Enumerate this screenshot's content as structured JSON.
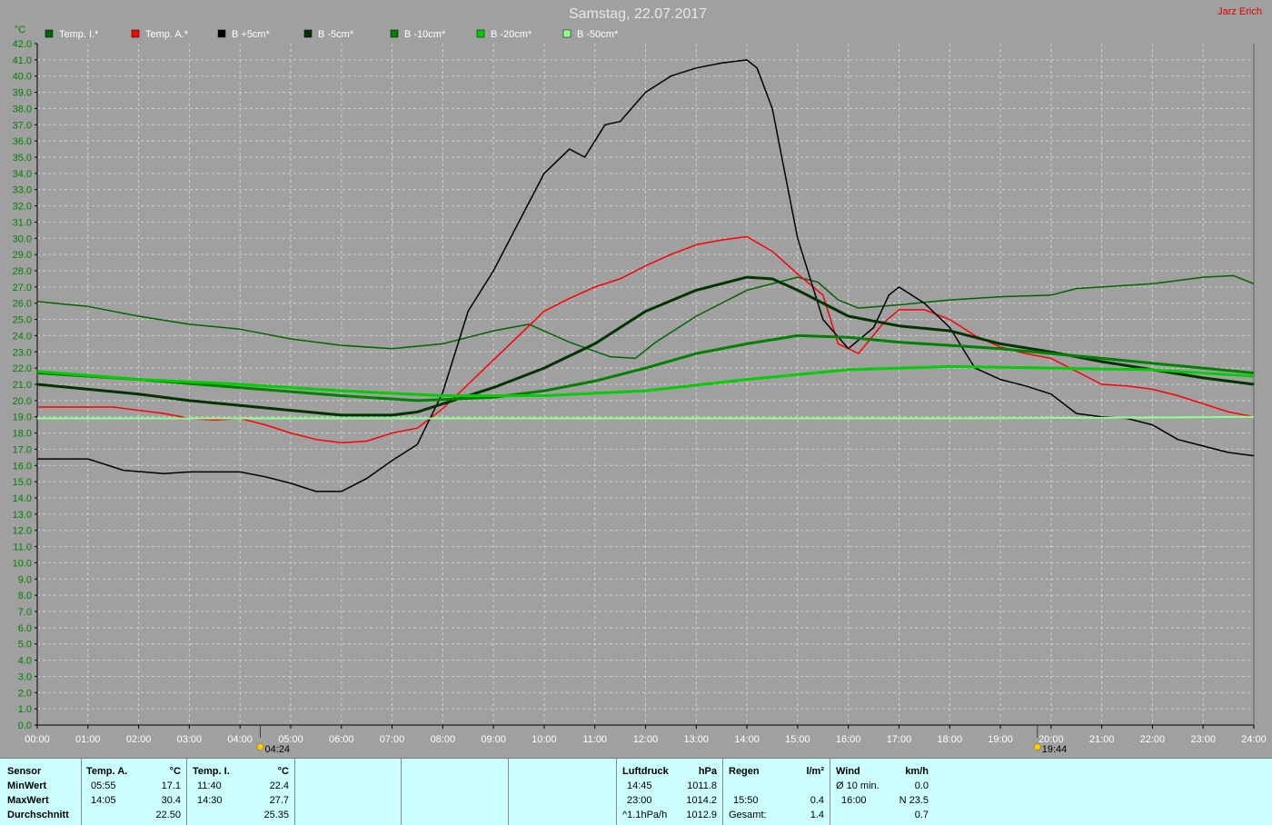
{
  "header": {
    "title": "Samstag, 22.07.2017",
    "author": "Jarz Erich"
  },
  "chart_data": {
    "type": "line",
    "title": "Samstag, 22.07.2017",
    "ylabel": "°C",
    "ylim": [
      0,
      42
    ],
    "xlim": [
      0,
      24
    ],
    "y_ticks": [
      "0.0",
      "1.0",
      "2.0",
      "3.0",
      "4.0",
      "5.0",
      "6.0",
      "7.0",
      "8.0",
      "9.0",
      "10.0",
      "11.0",
      "12.0",
      "13.0",
      "14.0",
      "15.0",
      "16.0",
      "17.0",
      "18.0",
      "19.0",
      "20.0",
      "21.0",
      "22.0",
      "23.0",
      "24.0",
      "25.0",
      "26.0",
      "27.0",
      "28.0",
      "29.0",
      "30.0",
      "31.0",
      "32.0",
      "33.0",
      "34.0",
      "35.0",
      "36.0",
      "37.0",
      "38.0",
      "39.0",
      "40.0",
      "41.0",
      "42.0"
    ],
    "x_ticks": [
      "00:00",
      "01:00",
      "02:00",
      "03:00",
      "04:00",
      "05:00",
      "06:00",
      "07:00",
      "08:00",
      "09:00",
      "10:00",
      "11:00",
      "12:00",
      "13:00",
      "14:00",
      "15:00",
      "16:00",
      "17:00",
      "18:00",
      "19:00",
      "20:00",
      "21:00",
      "22:00",
      "23:00",
      "24:00"
    ],
    "grid": true,
    "legend_position": "top",
    "sun_events": [
      {
        "label": "04:24",
        "hour": 4.4,
        "icon": "sunrise-icon"
      },
      {
        "label": "19:44",
        "hour": 19.73,
        "icon": "sunset-icon"
      }
    ],
    "series": [
      {
        "name": "Temp. I.*",
        "color": "#006400",
        "width": 1.5,
        "points": [
          [
            0,
            26.1
          ],
          [
            1,
            25.8
          ],
          [
            2,
            25.2
          ],
          [
            3,
            24.7
          ],
          [
            4,
            24.4
          ],
          [
            5,
            23.8
          ],
          [
            6,
            23.4
          ],
          [
            7,
            23.2
          ],
          [
            8,
            23.5
          ],
          [
            9,
            24.3
          ],
          [
            9.7,
            24.7
          ],
          [
            10.5,
            23.6
          ],
          [
            11.3,
            22.7
          ],
          [
            11.8,
            22.6
          ],
          [
            12.2,
            23.6
          ],
          [
            13,
            25.2
          ],
          [
            14,
            26.8
          ],
          [
            15,
            27.6
          ],
          [
            15.4,
            27.3
          ],
          [
            15.8,
            26.2
          ],
          [
            16.2,
            25.7
          ],
          [
            17,
            25.9
          ],
          [
            18,
            26.2
          ],
          [
            19,
            26.4
          ],
          [
            20,
            26.5
          ],
          [
            20.5,
            26.9
          ],
          [
            21,
            27.0
          ],
          [
            22,
            27.2
          ],
          [
            23,
            27.6
          ],
          [
            23.6,
            27.7
          ],
          [
            24,
            27.2
          ]
        ]
      },
      {
        "name": "Temp. A.*",
        "color": "#ff0000",
        "width": 1.5,
        "points": [
          [
            0,
            19.6
          ],
          [
            0.5,
            19.6
          ],
          [
            1,
            19.6
          ],
          [
            1.5,
            19.6
          ],
          [
            2,
            19.4
          ],
          [
            2.5,
            19.2
          ],
          [
            3,
            18.9
          ],
          [
            3.5,
            18.8
          ],
          [
            4,
            18.9
          ],
          [
            4.5,
            18.5
          ],
          [
            5,
            18.0
          ],
          [
            5.5,
            17.6
          ],
          [
            6,
            17.4
          ],
          [
            6.5,
            17.5
          ],
          [
            7,
            18.0
          ],
          [
            7.5,
            18.3
          ],
          [
            8,
            19.5
          ],
          [
            8.5,
            21.0
          ],
          [
            9,
            22.5
          ],
          [
            9.5,
            24.0
          ],
          [
            10,
            25.5
          ],
          [
            10.5,
            26.3
          ],
          [
            11,
            27.0
          ],
          [
            11.5,
            27.5
          ],
          [
            12,
            28.3
          ],
          [
            12.5,
            29.0
          ],
          [
            13,
            29.6
          ],
          [
            13.5,
            29.9
          ],
          [
            14,
            30.1
          ],
          [
            14.5,
            29.2
          ],
          [
            15,
            27.8
          ],
          [
            15.5,
            26.5
          ],
          [
            15.8,
            23.5
          ],
          [
            16.2,
            22.9
          ],
          [
            16.7,
            24.8
          ],
          [
            17,
            25.6
          ],
          [
            17.5,
            25.6
          ],
          [
            18,
            25.0
          ],
          [
            18.5,
            24.0
          ],
          [
            19,
            23.3
          ],
          [
            19.5,
            22.9
          ],
          [
            20,
            22.6
          ],
          [
            20.5,
            21.8
          ],
          [
            21,
            21.0
          ],
          [
            21.5,
            20.9
          ],
          [
            22,
            20.7
          ],
          [
            22.5,
            20.3
          ],
          [
            23,
            19.8
          ],
          [
            23.5,
            19.3
          ],
          [
            24,
            19.0
          ]
        ]
      },
      {
        "name": "B +5cm*",
        "color": "#000000",
        "width": 1.5,
        "points": [
          [
            0,
            16.4
          ],
          [
            1,
            16.4
          ],
          [
            1.7,
            15.7
          ],
          [
            2.5,
            15.5
          ],
          [
            3,
            15.6
          ],
          [
            4,
            15.6
          ],
          [
            4.5,
            15.3
          ],
          [
            5,
            14.9
          ],
          [
            5.5,
            14.4
          ],
          [
            6,
            14.4
          ],
          [
            6.5,
            15.2
          ],
          [
            7,
            16.3
          ],
          [
            7.5,
            17.3
          ],
          [
            8,
            20.5
          ],
          [
            8.5,
            25.5
          ],
          [
            9,
            28.0
          ],
          [
            9.5,
            31.0
          ],
          [
            10,
            34.0
          ],
          [
            10.5,
            35.5
          ],
          [
            10.8,
            35.0
          ],
          [
            11.2,
            37.0
          ],
          [
            11.5,
            37.2
          ],
          [
            12,
            39.0
          ],
          [
            12.5,
            40.0
          ],
          [
            13,
            40.5
          ],
          [
            13.5,
            40.8
          ],
          [
            14,
            41.0
          ],
          [
            14.2,
            40.5
          ],
          [
            14.5,
            38.0
          ],
          [
            15,
            30.0
          ],
          [
            15.5,
            25.0
          ],
          [
            16,
            23.2
          ],
          [
            16.5,
            24.5
          ],
          [
            16.8,
            26.5
          ],
          [
            17,
            27.0
          ],
          [
            17.5,
            26.0
          ],
          [
            18,
            24.5
          ],
          [
            18.5,
            22.0
          ],
          [
            19,
            21.3
          ],
          [
            19.5,
            20.9
          ],
          [
            20,
            20.4
          ],
          [
            20.5,
            19.2
          ],
          [
            21,
            19.0
          ],
          [
            21.5,
            18.9
          ],
          [
            22,
            18.5
          ],
          [
            22.5,
            17.6
          ],
          [
            23,
            17.2
          ],
          [
            23.5,
            16.8
          ],
          [
            24,
            16.6
          ]
        ]
      },
      {
        "name": "B -5cm*",
        "color": "#003300",
        "width": 3,
        "points": [
          [
            0,
            21.0
          ],
          [
            1,
            20.7
          ],
          [
            2,
            20.4
          ],
          [
            3,
            20.0
          ],
          [
            4,
            19.7
          ],
          [
            5,
            19.4
          ],
          [
            6,
            19.1
          ],
          [
            7,
            19.1
          ],
          [
            7.5,
            19.3
          ],
          [
            8,
            19.8
          ],
          [
            9,
            20.8
          ],
          [
            10,
            22.0
          ],
          [
            11,
            23.5
          ],
          [
            12,
            25.5
          ],
          [
            13,
            26.8
          ],
          [
            14,
            27.6
          ],
          [
            14.5,
            27.5
          ],
          [
            15,
            26.8
          ],
          [
            16,
            25.2
          ],
          [
            17,
            24.6
          ],
          [
            18,
            24.3
          ],
          [
            19,
            23.5
          ],
          [
            20,
            23.0
          ],
          [
            21,
            22.4
          ],
          [
            22,
            21.9
          ],
          [
            23,
            21.4
          ],
          [
            24,
            21.0
          ]
        ]
      },
      {
        "name": "B -10cm*",
        "color": "#008000",
        "width": 3,
        "points": [
          [
            0,
            21.7
          ],
          [
            2,
            21.3
          ],
          [
            4,
            20.8
          ],
          [
            6,
            20.3
          ],
          [
            7.5,
            20.0
          ],
          [
            9,
            20.2
          ],
          [
            10,
            20.6
          ],
          [
            11,
            21.2
          ],
          [
            12,
            22.0
          ],
          [
            13,
            22.9
          ],
          [
            14,
            23.5
          ],
          [
            15,
            24.0
          ],
          [
            16,
            23.9
          ],
          [
            17,
            23.6
          ],
          [
            18,
            23.4
          ],
          [
            19,
            23.2
          ],
          [
            20,
            22.9
          ],
          [
            21,
            22.6
          ],
          [
            22,
            22.3
          ],
          [
            23,
            22.0
          ],
          [
            24,
            21.7
          ]
        ]
      },
      {
        "name": "B -20cm*",
        "color": "#00cc00",
        "width": 3,
        "points": [
          [
            0,
            21.8
          ],
          [
            2,
            21.3
          ],
          [
            4,
            21.0
          ],
          [
            6,
            20.6
          ],
          [
            8,
            20.3
          ],
          [
            10,
            20.3
          ],
          [
            12,
            20.6
          ],
          [
            14,
            21.3
          ],
          [
            16,
            21.9
          ],
          [
            18,
            22.1
          ],
          [
            20,
            22.0
          ],
          [
            22,
            21.9
          ],
          [
            24,
            21.5
          ]
        ]
      },
      {
        "name": "B -50cm*",
        "color": "#90ff90",
        "width": 2,
        "points": [
          [
            0,
            18.9
          ],
          [
            6,
            18.9
          ],
          [
            12,
            18.9
          ],
          [
            18,
            18.9
          ],
          [
            22,
            18.95
          ],
          [
            24,
            19.0
          ]
        ]
      }
    ]
  },
  "stats": {
    "sensor_header": "Sensor",
    "row_min": "MinWert",
    "row_max": "MaxWert",
    "row_avg": "Durchschnitt",
    "temp_a": {
      "title": "Temp. A.",
      "unit": "°C",
      "min_time": "05:55",
      "min_val": "17.1",
      "max_time": "14:05",
      "max_val": "30.4",
      "avg": "22.50"
    },
    "temp_i": {
      "title": "Temp. I.",
      "unit": "°C",
      "min_time": "11:40",
      "min_val": "22.4",
      "max_time": "14:30",
      "max_val": "27.7",
      "avg": "25.35"
    },
    "pressure": {
      "title": "Luftdruck",
      "unit": "hPa",
      "min_time": "14:45",
      "min_val": "1011.8",
      "max_time": "23:00",
      "max_val": "1014.2",
      "trend_label": "^1.1hPa/h",
      "current": "1012.9"
    },
    "rain": {
      "title": "Regen",
      "unit": "l/m²",
      "row2_val": "0.4",
      "row2_time": "15:50",
      "total_label": "Gesamt:",
      "total": "1.4"
    },
    "wind": {
      "title": "Wind",
      "unit": "km/h",
      "avg_label": "Ø 10 min.",
      "avg_val": "0.0",
      "max_time": "16:00",
      "max_val": "N 23.5",
      "row3_val": "0.7"
    }
  }
}
